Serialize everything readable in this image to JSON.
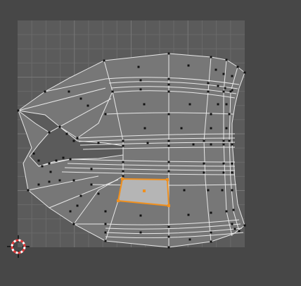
{
  "editor": {
    "name": "UV Editor",
    "mode": "face-select",
    "selected_faces": 1
  },
  "colors": {
    "background": "#474747",
    "uv_area": "#5b5b5b",
    "grid_minor": "#6a6a6a",
    "grid_major": "#777777",
    "mesh_fill": "#7a7a7a",
    "edge": "#e8e8e8",
    "vertex": "#111111",
    "selection": "#f0901e",
    "selected_fill": "#b5b5b5",
    "cursor_red": "#e23b3b"
  },
  "icons": {
    "cursor": "2d-cursor-icon"
  }
}
